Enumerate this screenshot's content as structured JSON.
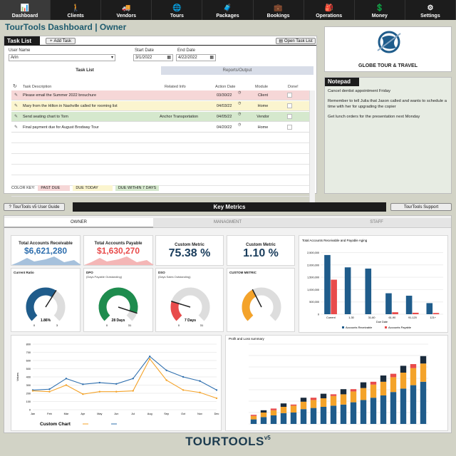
{
  "nav": [
    {
      "label": "Dashboard",
      "icon": "📊"
    },
    {
      "label": "Clients",
      "icon": "🚶"
    },
    {
      "label": "Vendors",
      "icon": "🚚"
    },
    {
      "label": "Tours",
      "icon": "🌐"
    },
    {
      "label": "Packages",
      "icon": "🧳"
    },
    {
      "label": "Bookings",
      "icon": "💼"
    },
    {
      "label": "Operations",
      "icon": "🎒"
    },
    {
      "label": "Money",
      "icon": "💲"
    },
    {
      "label": "Settings",
      "icon": "⚙"
    }
  ],
  "title": "TourTools Dashboard | Owner",
  "tasklist": {
    "header": "Task List",
    "add_btn": "Add Task",
    "open_btn": "Open Task List",
    "user_label": "User Name",
    "user_value": "Arin",
    "start_label": "Start Date",
    "start_value": "3/1/2022",
    "end_label": "End Date",
    "end_value": "4/22/2022",
    "tab_tasks": "Task List",
    "tab_reports": "Reports/Output",
    "col_desc": "Task Description",
    "col_info": "Related Info",
    "col_date": "Action Date",
    "col_module": "Module",
    "col_done": "Done!",
    "rows": [
      {
        "desc": "Please email the Summer 2022 brouchure",
        "info": "",
        "date": "03/30/22",
        "module": "Client",
        "color": "#f6d7d7"
      },
      {
        "desc": "Mary from the Hilton in Nashville called for rooming list",
        "info": "",
        "date": "04/03/22",
        "module": "Home",
        "color": "#fbf5cf"
      },
      {
        "desc": "Send seating chart to Tom",
        "info": "Anchor Transportation",
        "date": "04/05/22",
        "module": "Vendor",
        "color": "#d5e8cd"
      },
      {
        "desc": "Final payment due for August Brodway Tour",
        "info": "",
        "date": "04/20/22",
        "module": "Home",
        "color": "#ffffff"
      }
    ],
    "color_key": "COLOR KEY:",
    "key_past": "PAST DUE",
    "key_today": "DUE TODAY",
    "key_week": "DUE WITHIN 7 DAYS"
  },
  "logo_text": "GLOBE TOUR & TRAVEL",
  "notepad": {
    "header": "Notepad",
    "lines": [
      "Cancel dentist appointment Friday",
      "Remember to tell Julia that Jason called and wants to schedule a time with her for upgrading the copier",
      "Get lunch orders for the presentation next Monday"
    ]
  },
  "guide_btn": "TourTools v5 User Guide",
  "metrics_header": "Key Metrics",
  "support_btn": "TourTools Support",
  "metric_tabs": [
    "OWNER",
    "MANAGMENT",
    "STAFF"
  ],
  "kpis": [
    {
      "title": "Total Accounts Receivable",
      "value": "$6,621,280",
      "color": "#2f6fae"
    },
    {
      "title": "Total Accounts Payable",
      "value": "$1,630,270",
      "color": "#e84b4b"
    },
    {
      "title": "Custom Metric",
      "value": "75.38 %",
      "color": "#1a3d5c"
    },
    {
      "title": "Custom Metric",
      "value": "1.10 %",
      "color": "#1a3d5c"
    }
  ],
  "gauges": [
    {
      "title": "Current Ratio",
      "sub": "",
      "value": "1.86%",
      "min": "0",
      "max": "3",
      "fill": 0.62,
      "color": "#1f5c8b"
    },
    {
      "title": "DPO",
      "sub": "(Days Payable Outstanding)",
      "value": "28 Days",
      "min": "0",
      "max": "31",
      "fill": 0.9,
      "color": "#1e8c4e"
    },
    {
      "title": "DSO",
      "sub": "(Days Sales Outstanding)",
      "value": "7 Days",
      "min": "0",
      "max": "31",
      "fill": 0.23,
      "color": "#e84b4b"
    },
    {
      "title": "CUSTOM METRIC",
      "sub": "",
      "value": "",
      "min": "",
      "max": "",
      "fill": 0.4,
      "color": "#f4a32a"
    }
  ],
  "chart_data": [
    {
      "type": "bar",
      "title": "Total Accounts Receivable and Payable Aging",
      "xlabel": "Due Date",
      "categories": [
        "Current",
        "1-30",
        "31-60",
        "61-90",
        "91-120",
        "121+"
      ],
      "series": [
        {
          "name": "Accounts Receivable",
          "values": [
            2400000,
            1900000,
            1850000,
            850000,
            750000,
            450000
          ],
          "color": "#1f5c8b"
        },
        {
          "name": "Accounts Payable",
          "values": [
            1400000,
            0,
            0,
            80000,
            60000,
            50000
          ],
          "color": "#e84b4b"
        }
      ],
      "ylim": [
        0,
        2600000
      ],
      "yticks": [
        "0",
        "500,000",
        "1,000,000",
        "1,500,000",
        "2,000,000",
        "2,500,000"
      ]
    },
    {
      "type": "line",
      "title": "Custom Chart",
      "ylabel": "Values",
      "categories": [
        "Jan",
        "Feb",
        "Mar",
        "Apr",
        "May",
        "Jun",
        "Jul",
        "Aug",
        "Sep",
        "Oct",
        "Nov",
        "Dec"
      ],
      "series": [
        {
          "values": [
            240,
            250,
            380,
            310,
            330,
            315,
            380,
            650,
            480,
            400,
            350,
            240
          ],
          "color": "#2f6fae"
        },
        {
          "values": [
            230,
            220,
            300,
            190,
            220,
            220,
            230,
            620,
            360,
            240,
            210,
            140
          ],
          "color": "#f4a32a"
        }
      ],
      "ylim": [
        0,
        800
      ],
      "yticks": [
        "0",
        "100",
        "200",
        "300",
        "400",
        "500",
        "600",
        "700",
        "800"
      ]
    },
    {
      "type": "bar",
      "title": "Profit and Loss summary",
      "stacked": true,
      "series": [
        {
          "values": [
            80,
            120,
            150,
            190,
            200,
            260,
            280,
            300,
            320,
            340,
            380,
            420,
            460,
            500,
            560,
            620,
            680,
            740
          ],
          "color": "#1f5c8b"
        },
        {
          "values": [
            60,
            80,
            90,
            110,
            120,
            130,
            140,
            150,
            170,
            180,
            190,
            210,
            230,
            240,
            260,
            280,
            300,
            320
          ],
          "color": "#f4a32a"
        },
        {
          "values": [
            20,
            0,
            30,
            0,
            20,
            0,
            40,
            0,
            30,
            0,
            40,
            0,
            50,
            0,
            60,
            0,
            70,
            0
          ],
          "color": "#e84b4b"
        },
        {
          "values": [
            0,
            40,
            0,
            60,
            0,
            70,
            0,
            80,
            0,
            90,
            0,
            100,
            0,
            110,
            0,
            120,
            0,
            130
          ],
          "color": "#1a2b3c"
        }
      ],
      "ylim": [
        0,
        1400
      ]
    }
  ],
  "footer_brand": "TOURTOOLS",
  "footer_ver": "v5"
}
